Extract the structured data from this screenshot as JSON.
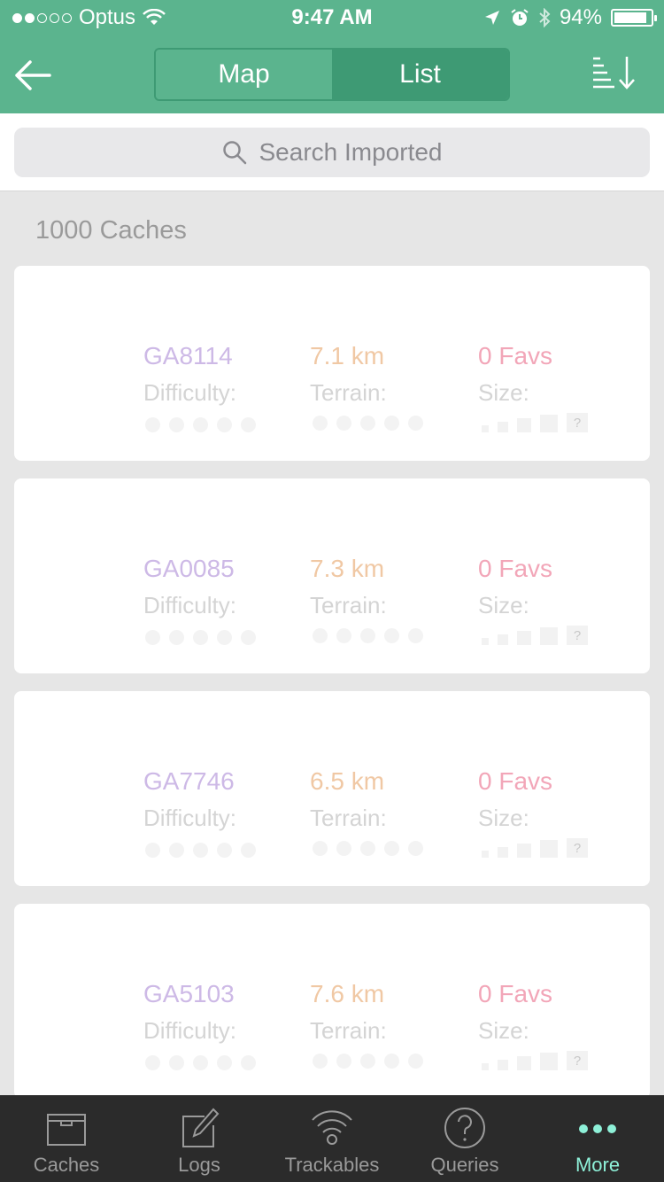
{
  "status_bar": {
    "carrier": "Optus",
    "time": "9:47 AM",
    "battery": "94%"
  },
  "header": {
    "segments": {
      "map": "Map",
      "list": "List"
    },
    "active_segment": "list"
  },
  "search": {
    "placeholder": "Search Imported"
  },
  "list": {
    "count_label": "1000 Caches",
    "caches": [
      {
        "code": "GA8114",
        "distance": "7.1 km",
        "favs": "0 Favs",
        "difficulty_label": "Difficulty:",
        "terrain_label": "Terrain:",
        "size_label": "Size:",
        "size_unknown": "?"
      },
      {
        "code": "GA0085",
        "distance": "7.3 km",
        "favs": "0 Favs",
        "difficulty_label": "Difficulty:",
        "terrain_label": "Terrain:",
        "size_label": "Size:",
        "size_unknown": "?"
      },
      {
        "code": "GA7746",
        "distance": "6.5 km",
        "favs": "0 Favs",
        "difficulty_label": "Difficulty:",
        "terrain_label": "Terrain:",
        "size_label": "Size:",
        "size_unknown": "?"
      },
      {
        "code": "GA5103",
        "distance": "7.6 km",
        "favs": "0 Favs",
        "difficulty_label": "Difficulty:",
        "terrain_label": "Terrain:",
        "size_label": "Size:",
        "size_unknown": "?"
      }
    ]
  },
  "tabbar": {
    "items": [
      {
        "label": "Caches",
        "icon": "box-icon"
      },
      {
        "label": "Logs",
        "icon": "edit-icon"
      },
      {
        "label": "Trackables",
        "icon": "signal-icon"
      },
      {
        "label": "Queries",
        "icon": "question-icon"
      },
      {
        "label": "More",
        "icon": "more-dots-icon"
      }
    ],
    "active": "More"
  },
  "colors": {
    "header": "#5bb48e",
    "segment_active": "#3e9a74",
    "tab_active": "#8ef0d8",
    "tabbar_bg": "#2b2b2b"
  }
}
